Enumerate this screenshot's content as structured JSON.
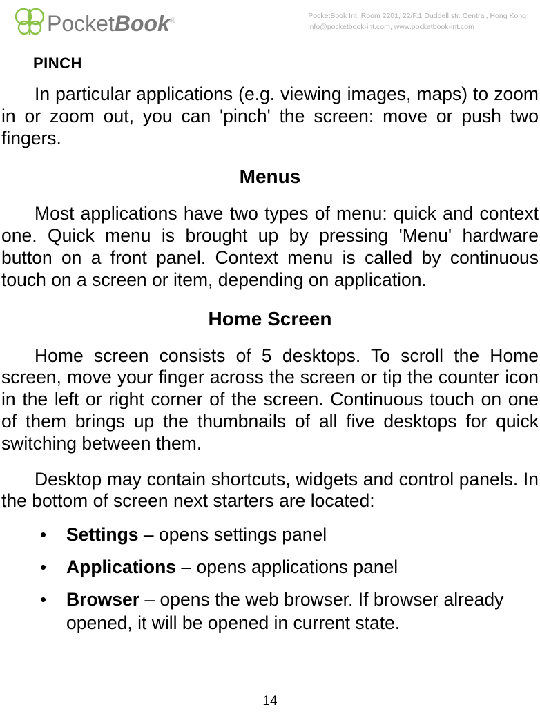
{
  "header": {
    "logo_text_1": "Pocket",
    "logo_text_2": "Book",
    "logo_reg": "®",
    "company_line1": "PocketBook Int. Room 2201, 22/F.1 Duddell str. Central, Hong Kong",
    "company_line2": "info@pocketbook-int.com, www.pocketbook-int.com"
  },
  "sections": {
    "pinch_title": "PINCH",
    "pinch_para": "In particular applications (e.g. viewing images, maps) to zoom in or zoom out, you can 'pinch' the screen: move or push two fingers.",
    "menus_title": "Menus",
    "menus_para": "Most applications have two types of menu: quick and context one. Quick menu is brought up by pressing 'Menu' hardware button on a front panel. Context menu is called by continuous touch on a screen or item, depending on application.",
    "home_title": "Home Screen",
    "home_para1": "Home screen consists of 5 desktops. To scroll the Home screen, move your finger across the screen or tip the counter icon in the left or right corner of the screen. Continuous touch on one of them brings up the thumbnails of all five desktops for quick switching between them.",
    "home_para2": "Desktop may contain shortcuts, widgets and control panels. In the bottom of screen next starters are located:",
    "bullets": [
      {
        "term": "Settings",
        "desc": " – opens settings panel"
      },
      {
        "term": "Applications",
        "desc": " – opens applications panel"
      },
      {
        "term": "Browser",
        "desc": " – opens the web browser. If browser already opened, it will be opened in current state."
      }
    ]
  },
  "page_number": "14"
}
